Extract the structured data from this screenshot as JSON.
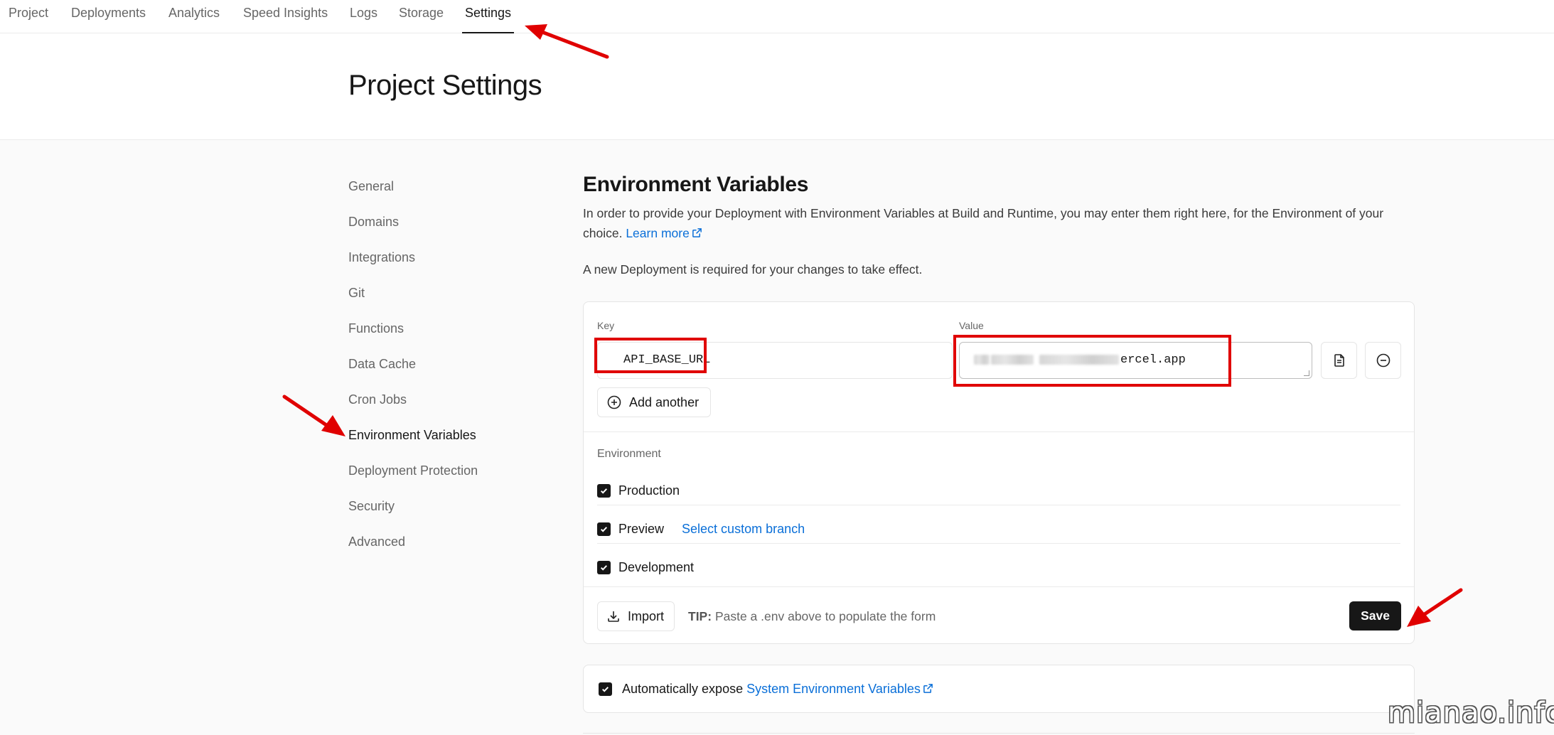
{
  "topnav": {
    "tabs": [
      {
        "label": "Project"
      },
      {
        "label": "Deployments"
      },
      {
        "label": "Analytics"
      },
      {
        "label": "Speed Insights"
      },
      {
        "label": "Logs"
      },
      {
        "label": "Storage"
      },
      {
        "label": "Settings",
        "active": true
      }
    ]
  },
  "header": {
    "title": "Project Settings"
  },
  "sidebar": {
    "items": [
      {
        "label": "General"
      },
      {
        "label": "Domains"
      },
      {
        "label": "Integrations"
      },
      {
        "label": "Git"
      },
      {
        "label": "Functions"
      },
      {
        "label": "Data Cache"
      },
      {
        "label": "Cron Jobs"
      },
      {
        "label": "Environment Variables",
        "active": true
      },
      {
        "label": "Deployment Protection"
      },
      {
        "label": "Security"
      },
      {
        "label": "Advanced"
      }
    ]
  },
  "main": {
    "title": "Environment Variables",
    "description": "In order to provide your Deployment with Environment Variables at Build and Runtime, you may enter them right here, for the Environment of your choice.",
    "learn_more": "Learn more",
    "note": "A new Deployment is required for your changes to take effect.",
    "form": {
      "key_label": "Key",
      "value_label": "Value",
      "key_value": "API_BASE_URL",
      "value_visible_suffix": "ercel.app",
      "add_another": "Add another",
      "environment_label": "Environment",
      "environments": [
        {
          "label": "Production",
          "checked": true
        },
        {
          "label": "Preview",
          "checked": true,
          "link": "Select custom branch"
        },
        {
          "label": "Development",
          "checked": true
        }
      ],
      "import_label": "Import",
      "tip_label": "TIP:",
      "tip_text": "Paste a .env above to populate the form",
      "save_label": "Save"
    },
    "system_env": {
      "prefix": "Automatically expose",
      "link": "System Environment Variables",
      "checked": true
    }
  },
  "watermark": "mianao.info",
  "colors": {
    "accent": "#0a6fd8",
    "annotation": "#e00000",
    "primary_button": "#171717"
  },
  "icons": [
    "external-link-icon",
    "document-icon",
    "minus-circle-icon",
    "plus-circle-icon",
    "check-icon",
    "download-icon"
  ]
}
